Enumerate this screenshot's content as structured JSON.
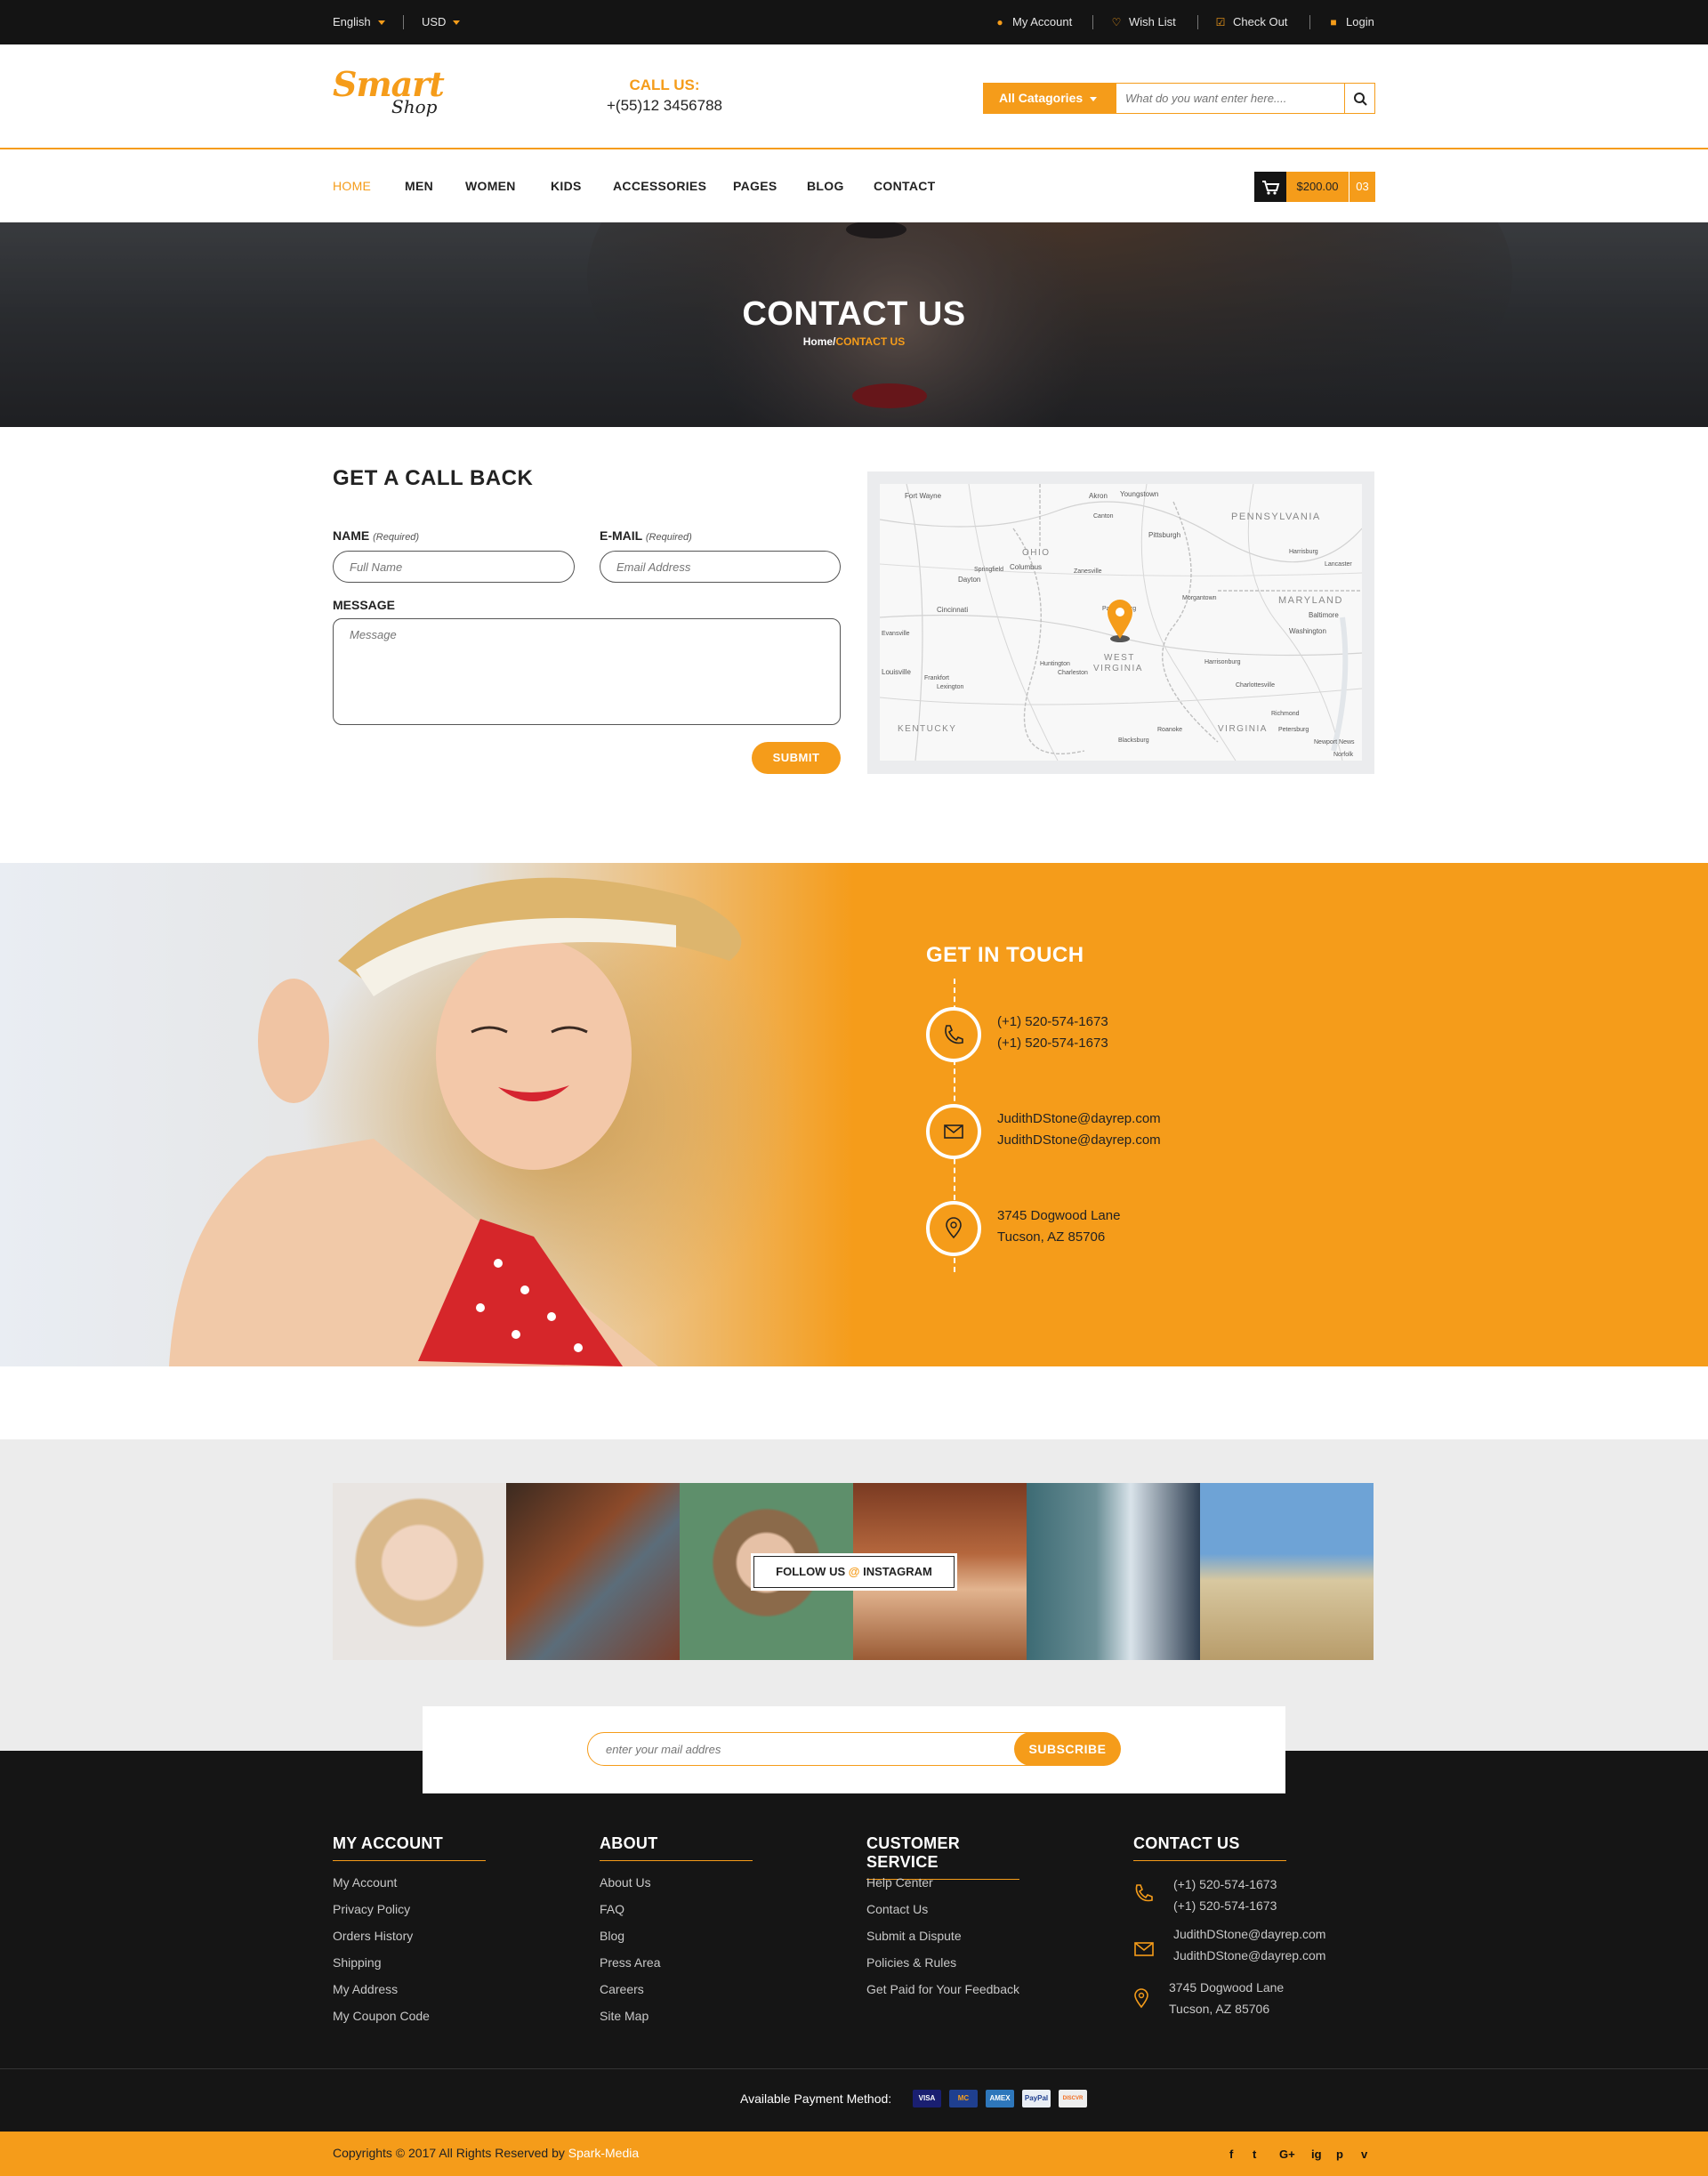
{
  "topbar": {
    "language": "English",
    "currency": "USD",
    "my_account": "My Account",
    "wish_list": "Wish List",
    "check_out": "Check Out",
    "login": "Login"
  },
  "header": {
    "logo_main": "Smart",
    "logo_sub": "Shop",
    "call_label": "CALL US:",
    "call_number": "+(55)12 3456788",
    "categories_label": "All Catagories",
    "search_placeholder": "What do you want enter here....",
    "search_icon": "search-icon"
  },
  "nav": {
    "items": [
      "HOME",
      "MEN",
      "WOMEN",
      "KIDS",
      "ACCESSORIES",
      "PAGES",
      "BLOG",
      "CONTACT"
    ],
    "active": "HOME"
  },
  "cart": {
    "total": "$200.00",
    "count": "03",
    "icon": "cart-icon"
  },
  "hero": {
    "title": "CONTACT US",
    "crumb_home": "Home/",
    "crumb_current": "CONTACT US"
  },
  "callback": {
    "title": "GET A CALL BACK",
    "name_label": "NAME",
    "name_req": "(Required)",
    "name_placeholder": "Full Name",
    "email_label": "E-MAIL",
    "email_req": "(Required)",
    "email_placeholder": "Email Address",
    "message_label": "MESSAGE",
    "message_placeholder": "Message",
    "submit_label": "SUBMIT"
  },
  "map": {
    "labels": [
      "Fort Wayne",
      "Akron",
      "Youngstown",
      "PENNSYLVANIA",
      "OHIO",
      "Columbus",
      "Pittsburgh",
      "Springfield",
      "Zanesville",
      "Harrisburg",
      "Dayton",
      "Lancaster",
      "Cincinnati",
      "Parkersburg",
      "MARYLAND",
      "Baltimore",
      "Washington",
      "WEST",
      "VIRGINIA",
      "Louisville",
      "Frankfort",
      "Lexington",
      "Huntington",
      "Charleston",
      "Harrisonburg",
      "Charlottesville",
      "Richmond",
      "KENTUCKY",
      "Roanoke",
      "VIRGINIA",
      "Petersburg",
      "Blacksburg",
      "Newport News",
      "Norfolk",
      "Canton",
      "Morgantown",
      "Evansville"
    ],
    "pin_icon": "map-pin-icon"
  },
  "touch": {
    "title": "GET IN TOUCH",
    "phone1": "(+1) 520-574-1673",
    "phone2": "(+1) 520-574-1673",
    "email1": "JudithDStone@dayrep.com",
    "email2": "JudithDStone@dayrep.com",
    "address1": "3745 Dogwood Lane",
    "address2": "Tucson, AZ 85706"
  },
  "instagram": {
    "follow_prefix": "FOLLOW US",
    "at": "@",
    "follow_suffix": "INSTAGRAM"
  },
  "newsletter": {
    "placeholder": "enter your mail addres",
    "subscribe_label": "SUBSCRIBE"
  },
  "footer": {
    "col1": {
      "title": "MY ACCOUNT",
      "links": [
        "My Account",
        "Privacy Policy",
        "Orders History",
        "Shipping",
        "My Address",
        "My Coupon Code"
      ]
    },
    "col2": {
      "title": "ABOUT",
      "links": [
        "About Us",
        "FAQ",
        "Blog",
        "Press Area",
        "Careers",
        "Site Map"
      ]
    },
    "col3": {
      "title": "CUSTOMER SERVICE",
      "links": [
        "Help Center",
        "Contact Us",
        "Submit a Dispute",
        "Policies & Rules",
        "Get Paid for Your Feedback"
      ]
    },
    "col4": {
      "title": "CONTACT US",
      "phone1": "(+1) 520-574-1673",
      "phone2": "(+1) 520-574-1673",
      "email1": "JudithDStone@dayrep.com",
      "email2": "JudithDStone@dayrep.com",
      "address1": "3745 Dogwood Lane",
      "address2": "Tucson, AZ 85706"
    },
    "payment_label": "Available Payment Method:",
    "cards": [
      "VISA",
      "MC",
      "AMEX",
      "PayPal",
      "DISCVR"
    ],
    "copyright": "Copyrights © 2017 All Rights Reserved by ",
    "brand": "Spark-Media",
    "social": [
      "f",
      "t",
      "G+",
      "ig",
      "p",
      "v"
    ]
  },
  "colors": {
    "accent": "#f59c1a",
    "dark": "#141414",
    "text": "#222222"
  }
}
